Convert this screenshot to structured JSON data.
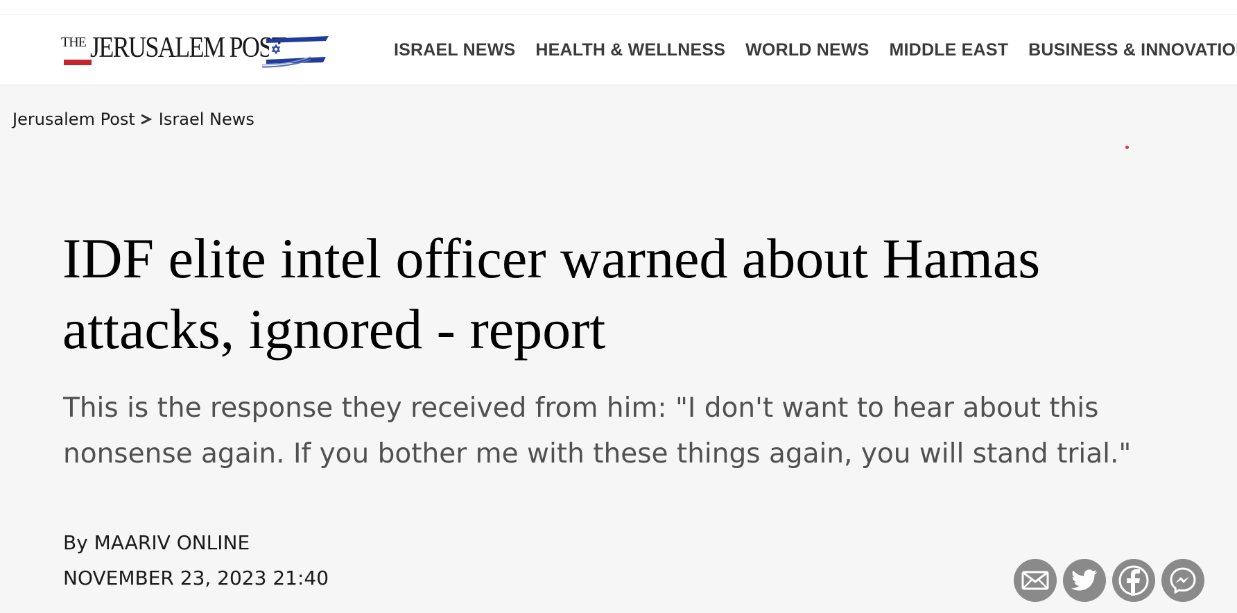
{
  "header": {
    "logo": {
      "the": "THE",
      "name": "JERUSALEM POST"
    },
    "nav": [
      {
        "label": "ISRAEL NEWS"
      },
      {
        "label": "HEALTH & WELLNESS"
      },
      {
        "label": "WORLD NEWS"
      },
      {
        "label": "MIDDLE EAST"
      },
      {
        "label": "BUSINESS & INNOVATION"
      }
    ]
  },
  "breadcrumb": {
    "home": "Jerusalem Post",
    "section": "Israel News"
  },
  "article": {
    "headline": "IDF elite intel officer warned about Hamas attacks, ignored - report",
    "subheadline": "This is the response they received from him: \"I don't want to hear about this nonsense again. If you bother me with these things again, you will stand trial.\"",
    "byline": "By MAARIV ONLINE",
    "date": "NOVEMBER 23, 2023 21:40"
  },
  "share": [
    {
      "icon": "email-icon"
    },
    {
      "icon": "twitter-icon"
    },
    {
      "icon": "facebook-icon"
    },
    {
      "icon": "messenger-icon"
    }
  ],
  "colors": {
    "background": "#f6f6f6",
    "nav_text": "#3b3b3b",
    "subhead_text": "#505050",
    "share_button": "#8a8a8a",
    "logo_red": "#c8222a",
    "logo_blue": "#1f3c9a"
  }
}
